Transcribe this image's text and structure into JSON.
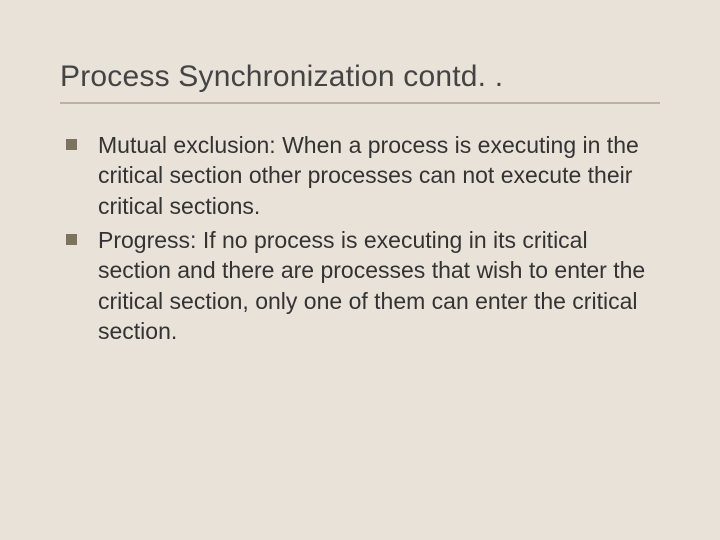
{
  "slide": {
    "title": "Process Synchronization contd. .",
    "bullets": [
      "Mutual exclusion: When a process is executing in the critical section other processes can not execute their critical sections.",
      "Progress: If no process is executing in its critical section and there are processes that wish to enter the critical section, only one of them can enter the critical section."
    ]
  }
}
